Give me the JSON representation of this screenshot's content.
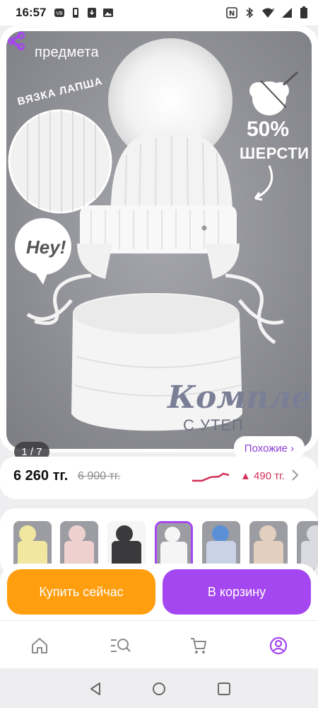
{
  "status_bar": {
    "time": "16:57",
    "icons": [
      "vk-icon",
      "phone-icon",
      "download-icon",
      "image-icon",
      "nfc-icon",
      "bluetooth-icon",
      "wifi-icon",
      "signal-icon",
      "battery-icon"
    ]
  },
  "product": {
    "brand": "предмета",
    "image_badge_viazka": "ВЯЗКА ЛАПША",
    "image_badge_wool_pct": "50%",
    "image_badge_wool_txt": "ШЕРСТИ",
    "image_bubble": "Hey!",
    "image_title": "Комплект",
    "image_subtitle": "С УТЕП",
    "page_indicator": "1 / 7",
    "similar_label": "Похожие ›"
  },
  "price": {
    "current": "6 260 тг.",
    "old": "6 900 тг.",
    "change": "▲ 490 тг.",
    "accent_color": "#d23159"
  },
  "variants": {
    "colors": [
      "#f1e7a0",
      "#eed1cf",
      "#3a3a3c",
      "#f5f5f5",
      "#c9d2e6",
      "#e3cfbe",
      "#d9dbe0"
    ],
    "selected_index": 3
  },
  "actions": {
    "buy_now": "Купить сейчас",
    "add_to_cart": "В корзину",
    "buy_color": "#ff9e0f",
    "cart_color": "#a547f0"
  },
  "bottom_nav": {
    "items": [
      "home-icon",
      "catalog-search-icon",
      "cart-icon",
      "profile-icon"
    ],
    "active": "profile-icon",
    "active_color": "#a547f0"
  }
}
